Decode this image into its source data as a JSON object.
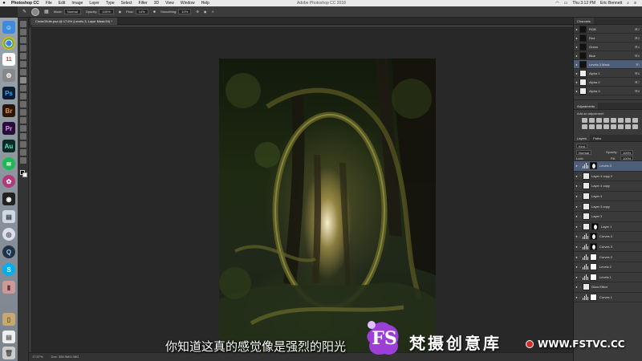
{
  "menubar": {
    "app": "Photoshop CC",
    "items": [
      "File",
      "Edit",
      "Image",
      "Layer",
      "Type",
      "Select",
      "Filter",
      "3D",
      "View",
      "Window",
      "Help"
    ],
    "window_title": "Adobe Photoshop CC 2018",
    "clock": "Thu 3:12 PM",
    "user": "Eric Bennett"
  },
  "options": {
    "mode_label": "Mode:",
    "mode_value": "Normal",
    "opacity_label": "Opacity:",
    "opacity_value": "100%",
    "flow_label": "Flow:",
    "flow_value": "14%",
    "smoothing_label": "Smoothing:",
    "smoothing_value": "10%"
  },
  "document": {
    "tab_title": "CircleOfLife.psd @ 17.6% (Levels 3, Layer Mask/16) *"
  },
  "status": {
    "zoom": "17.57%",
    "doc": "Doc: 358.9M/4.08G"
  },
  "channels": {
    "tabs": [
      "Channels"
    ],
    "rows": [
      {
        "label": "RGB",
        "key": "⌘2",
        "thumb": "dark"
      },
      {
        "label": "Red",
        "key": "⌘3",
        "thumb": "dark"
      },
      {
        "label": "Green",
        "key": "⌘4",
        "thumb": "dark"
      },
      {
        "label": "Blue",
        "key": "⌘5",
        "thumb": "dark"
      },
      {
        "label": "Levels 3 Mask",
        "key": "⌘\\",
        "thumb": "dark"
      },
      {
        "label": "Alpha 1",
        "key": "⌘6",
        "thumb": "white"
      },
      {
        "label": "Alpha 2",
        "key": "⌘7",
        "thumb": "white"
      },
      {
        "label": "Alpha 3",
        "key": "⌘8",
        "thumb": "white"
      }
    ]
  },
  "adjustments": {
    "tabs": [
      "Adjustments"
    ],
    "add_label": "Add an adjustment"
  },
  "layers": {
    "tabs": [
      "Layers",
      "Paths"
    ],
    "kind_label": "Kind",
    "blend_mode": "Normal",
    "opacity_label": "Opacity:",
    "opacity_value": "100%",
    "lock_label": "Lock:",
    "fill_label": "Fill:",
    "fill_value": "100%",
    "rows": [
      {
        "label": "Levels 3",
        "type": "adjustment",
        "mask": "black",
        "selected": true
      },
      {
        "label": "Layer 4 copy 2",
        "type": "pixel",
        "mask": "none",
        "selected": false
      },
      {
        "label": "Layer 4 copy",
        "type": "pixel",
        "mask": "none",
        "selected": false
      },
      {
        "label": "Layer 4",
        "type": "pixel",
        "mask": "none",
        "selected": false
      },
      {
        "label": "Layer 3 copy",
        "type": "pixel",
        "mask": "none",
        "selected": false
      },
      {
        "label": "Layer 3",
        "type": "pixel",
        "mask": "none",
        "selected": false
      },
      {
        "label": "Layer 1",
        "type": "pixel",
        "mask": "black",
        "selected": false
      },
      {
        "label": "Curves 4",
        "type": "adjustment",
        "mask": "black",
        "selected": false
      },
      {
        "label": "Curves 3",
        "type": "adjustment",
        "mask": "black",
        "selected": false
      },
      {
        "label": "Curves 2",
        "type": "adjustment",
        "mask": "white",
        "selected": false
      },
      {
        "label": "Levels 2",
        "type": "adjustment",
        "mask": "white",
        "selected": false
      },
      {
        "label": "Levels 1",
        "type": "adjustment",
        "mask": "white",
        "selected": false
      },
      {
        "label": "Glow Effect",
        "type": "pixel",
        "mask": "none",
        "selected": false
      },
      {
        "label": "Curves 1",
        "type": "adjustment",
        "mask": "white",
        "selected": false
      }
    ]
  },
  "overlay": {
    "subtitle": "你知道这真的感觉像是强烈的阳光",
    "brand": "梵摄创意库",
    "url": "WWW.FSTVC.CC",
    "logo_letters": "FS",
    "accent": "#9b3fd8"
  }
}
